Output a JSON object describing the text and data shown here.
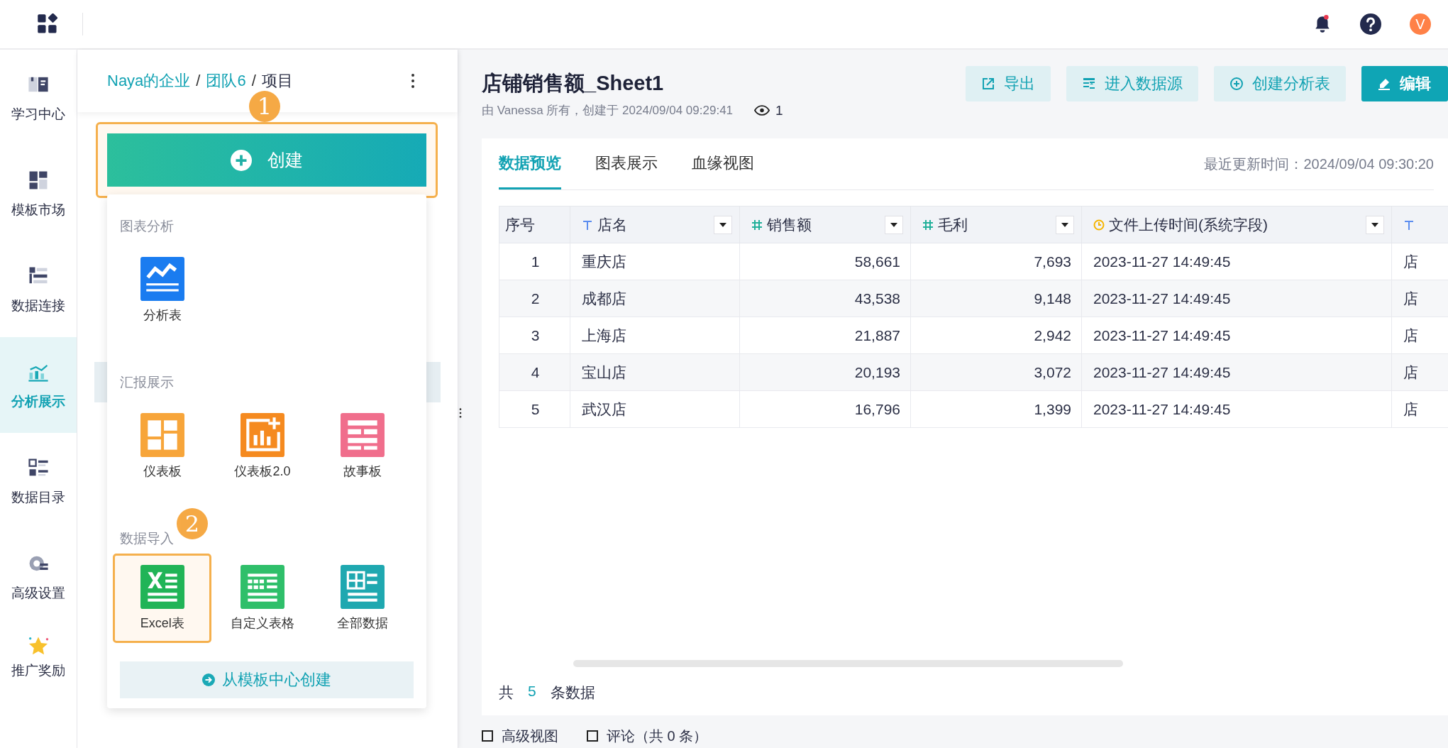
{
  "topbar": {
    "avatar": "V",
    "has_notification": true
  },
  "nav": [
    {
      "label": "学习中心",
      "selected": false
    },
    {
      "label": "模板市场",
      "selected": false
    },
    {
      "label": "数据连接",
      "selected": false
    },
    {
      "label": "分析展示",
      "selected": true
    },
    {
      "label": "数据目录",
      "selected": false
    },
    {
      "label": "高级设置",
      "selected": false
    },
    {
      "label": "推广奖励",
      "selected": false
    }
  ],
  "breadcrumb": {
    "items": [
      {
        "label": "Naya的企业",
        "link": true
      },
      {
        "label": "团队6",
        "link": true
      },
      {
        "label": "项目",
        "link": false
      }
    ],
    "separator": "/"
  },
  "create_button": {
    "label": "创建",
    "step": "1"
  },
  "create_menu": {
    "sections": [
      {
        "title": "图表分析",
        "items": [
          {
            "label": "分析表",
            "color": "#1a7cf0",
            "selected": false
          }
        ]
      },
      {
        "title": "汇报展示",
        "items": [
          {
            "label": "仪表板",
            "color": "#f7a53a",
            "selected": false
          },
          {
            "label": "仪表板2.0",
            "color": "#f58a1f",
            "selected": false
          },
          {
            "label": "故事板",
            "color": "#f06e8c",
            "selected": false
          }
        ]
      },
      {
        "title": "数据导入",
        "step": "2",
        "items": [
          {
            "label": "Excel表",
            "color": "#21b457",
            "selected": true
          },
          {
            "label": "自定义表格",
            "color": "#2fbf6a",
            "selected": false
          },
          {
            "label": "全部数据",
            "color": "#1fa8b0",
            "selected": false
          }
        ]
      }
    ],
    "template_button": "从模板中心创建"
  },
  "document": {
    "title": "店铺销售额_Sheet1",
    "meta": "由 Vanessa 所有，创建于 2024/09/04 09:29:41",
    "views": "1",
    "actions": [
      {
        "label": "导出",
        "primary": false
      },
      {
        "label": "进入数据源",
        "primary": false
      },
      {
        "label": "创建分析表",
        "primary": false
      },
      {
        "label": "编辑",
        "primary": true
      }
    ]
  },
  "tabs": [
    {
      "label": "数据预览",
      "selected": true
    },
    {
      "label": "图表展示",
      "selected": false
    },
    {
      "label": "血缘视图",
      "selected": false
    }
  ],
  "last_updated": "最近更新时间：2024/09/04 09:30:20",
  "table": {
    "columns": [
      {
        "name": "序号",
        "kind": "index"
      },
      {
        "name": "店名",
        "kind": "text"
      },
      {
        "name": "销售额",
        "kind": "number"
      },
      {
        "name": "毛利",
        "kind": "number"
      },
      {
        "name": "文件上传时间(系统字段)",
        "kind": "time"
      },
      {
        "kind": "text"
      }
    ],
    "rows": [
      [
        "1",
        "重庆店",
        "58,661",
        "7,693",
        "2023-11-27 14:49:45",
        "店"
      ],
      [
        "2",
        "成都店",
        "43,538",
        "9,148",
        "2023-11-27 14:49:45",
        "店"
      ],
      [
        "3",
        "上海店",
        "21,887",
        "2,942",
        "2023-11-27 14:49:45",
        "店"
      ],
      [
        "4",
        "宝山店",
        "20,193",
        "3,072",
        "2023-11-27 14:49:45",
        "店"
      ],
      [
        "5",
        "武汉店",
        "16,796",
        "1,399",
        "2023-11-27 14:49:45",
        "店"
      ]
    ]
  },
  "footer": {
    "prefix": "共",
    "count": "5",
    "suffix": "条数据"
  },
  "bottom_tabs": [
    "高级视图",
    "评论（共 0 条）"
  ]
}
